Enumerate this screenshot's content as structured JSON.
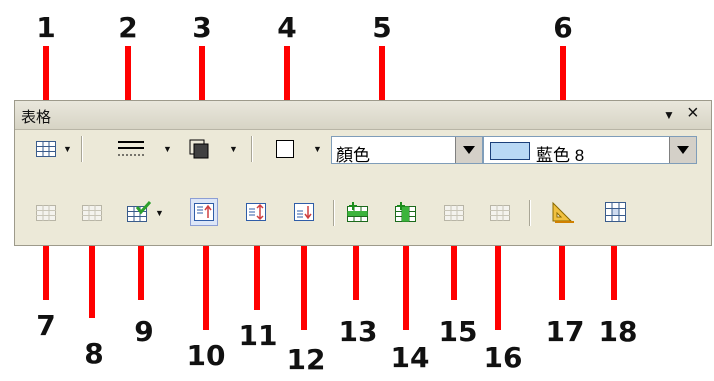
{
  "panel": {
    "title": "表格",
    "pin_icon": "dropdown-triangle-icon",
    "close_icon": "close-icon",
    "close_glyph": "×",
    "menu_glyph": "▼"
  },
  "toolbar_row1": {
    "table_button": "table-grid-icon",
    "border_style_button": "line-style-icon",
    "border_color_button": "border-color-icon",
    "borders_button": "borders-icon",
    "area_style": {
      "value": "顏色"
    },
    "fill_color": {
      "value": "藍色 8",
      "swatch_color": "#b9d8f5"
    }
  },
  "toolbar_row2": {
    "buttons": [
      {
        "name": "merge-cells-icon"
      },
      {
        "name": "split-cells-icon"
      },
      {
        "name": "autoformat-icon"
      },
      {
        "name": "align-top-icon"
      },
      {
        "name": "center-vertically-icon"
      },
      {
        "name": "align-bottom-icon"
      },
      {
        "name": "insert-row-icon"
      },
      {
        "name": "insert-column-icon"
      },
      {
        "name": "delete-row-icon"
      },
      {
        "name": "delete-column-icon"
      },
      {
        "name": "table-properties-icon"
      },
      {
        "name": "sum-icon"
      }
    ]
  },
  "labels": [
    "1",
    "2",
    "3",
    "4",
    "5",
    "6",
    "7",
    "8",
    "9",
    "10",
    "11",
    "12",
    "13",
    "14",
    "15",
    "16",
    "17",
    "18"
  ],
  "accent": "#ff0000"
}
